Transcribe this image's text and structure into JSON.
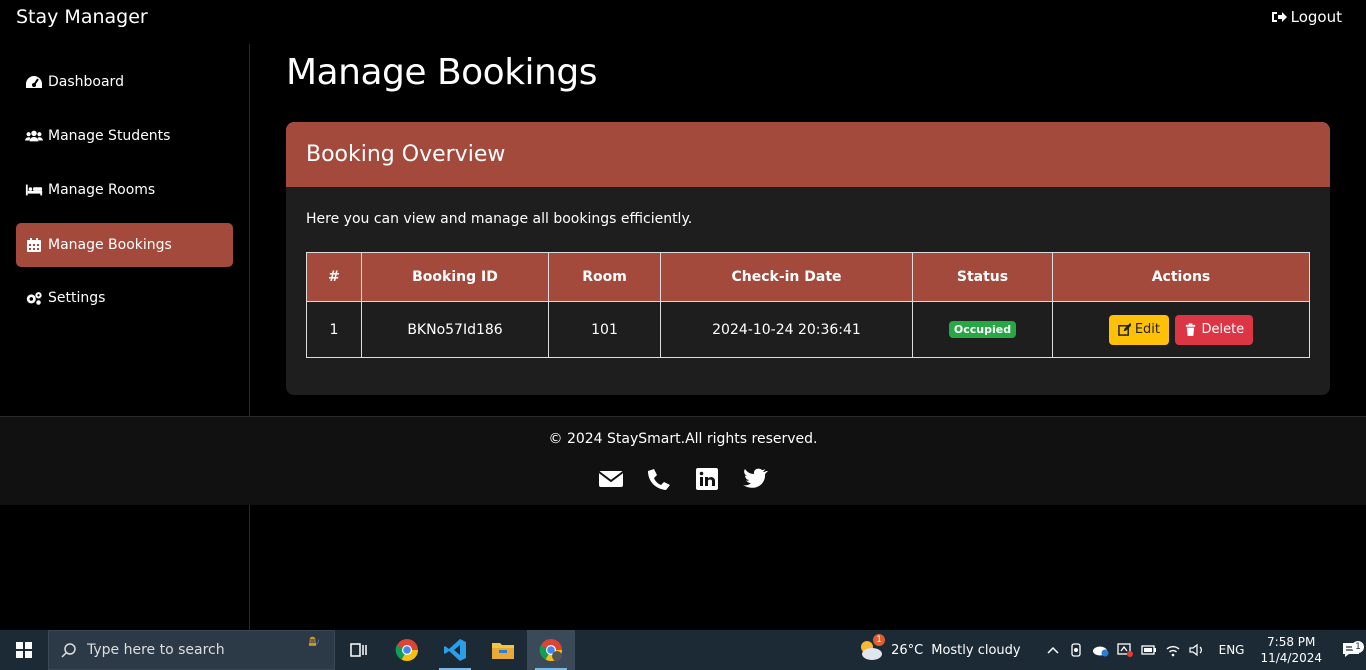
{
  "app": {
    "title": "Stay Manager",
    "logout_label": "Logout"
  },
  "sidebar": {
    "items": [
      {
        "label": "Dashboard",
        "icon": "gauge-icon"
      },
      {
        "label": "Manage Students",
        "icon": "users-icon"
      },
      {
        "label": "Manage Rooms",
        "icon": "bed-icon"
      },
      {
        "label": "Manage Bookings",
        "icon": "calendar-icon",
        "active": true
      },
      {
        "label": "Settings",
        "icon": "cogs-icon"
      }
    ]
  },
  "page": {
    "title": "Manage Bookings"
  },
  "card": {
    "header": "Booking Overview",
    "description": "Here you can view and manage all bookings efficiently."
  },
  "table": {
    "headers": [
      "#",
      "Booking ID",
      "Room",
      "Check-in Date",
      "Status",
      "Actions"
    ],
    "rows": [
      {
        "num": "1",
        "booking_id": "BKNo57Id186",
        "room": "101",
        "checkin": "2024-10-24 20:36:41",
        "status": "Occupied"
      }
    ],
    "edit_label": "Edit",
    "delete_label": "Delete"
  },
  "footer": {
    "copyright": "© 2024 StaySmart.All rights reserved.",
    "social_icons": [
      "envelope-icon",
      "phone-icon",
      "linkedin-icon",
      "twitter-icon"
    ]
  },
  "taskbar": {
    "search_placeholder": "Type here to search",
    "weather_temp": "26°C",
    "weather_desc": "Mostly cloudy",
    "weather_badge": "1",
    "language": "ENG",
    "time": "7:58 PM",
    "date": "11/4/2024",
    "notification_count": "1"
  },
  "colors": {
    "accent": "#a34a3d",
    "success": "#28a745",
    "warning": "#ffc107",
    "danger": "#dc3545",
    "card_bg": "#1e1e1e"
  }
}
